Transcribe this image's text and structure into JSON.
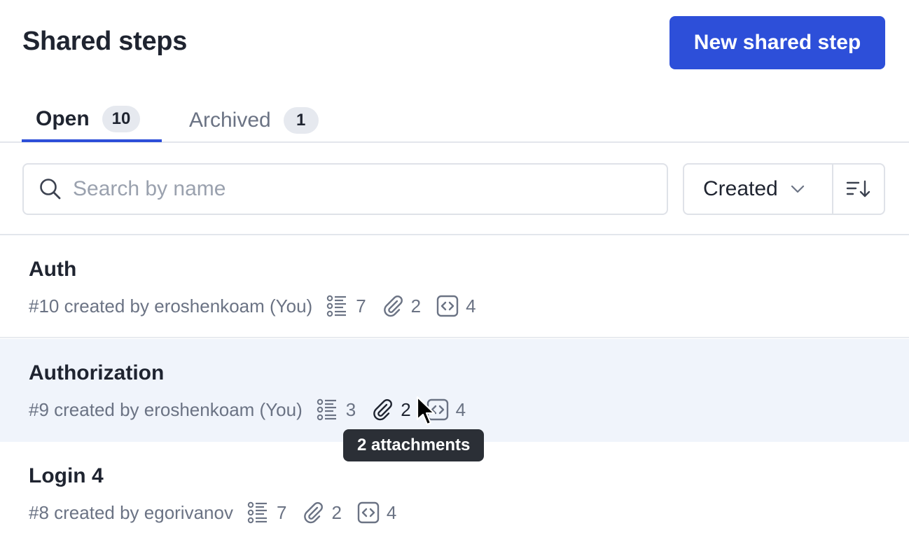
{
  "header": {
    "title": "Shared steps",
    "new_button_label": "New shared step"
  },
  "tabs": [
    {
      "label": "Open",
      "count": "10",
      "active": true
    },
    {
      "label": "Archived",
      "count": "1",
      "active": false
    }
  ],
  "search": {
    "placeholder": "Search by name",
    "value": ""
  },
  "sort": {
    "selected": "Created"
  },
  "items": [
    {
      "name": "Auth",
      "meta": "#10 created by eroshenkoam (You)",
      "steps": "7",
      "attachments": "2",
      "code": "4"
    },
    {
      "name": "Authorization",
      "meta": "#9 created by eroshenkoam (You)",
      "steps": "3",
      "attachments": "2",
      "code": "4"
    },
    {
      "name": "Login 4",
      "meta": "#8 created by egorivanov",
      "steps": "7",
      "attachments": "2",
      "code": "4"
    }
  ],
  "tooltip": {
    "text": "2 attachments"
  },
  "colors": {
    "accent": "#2d4fd9",
    "hover_row": "#f0f4fb",
    "muted_text": "#6b7384"
  }
}
